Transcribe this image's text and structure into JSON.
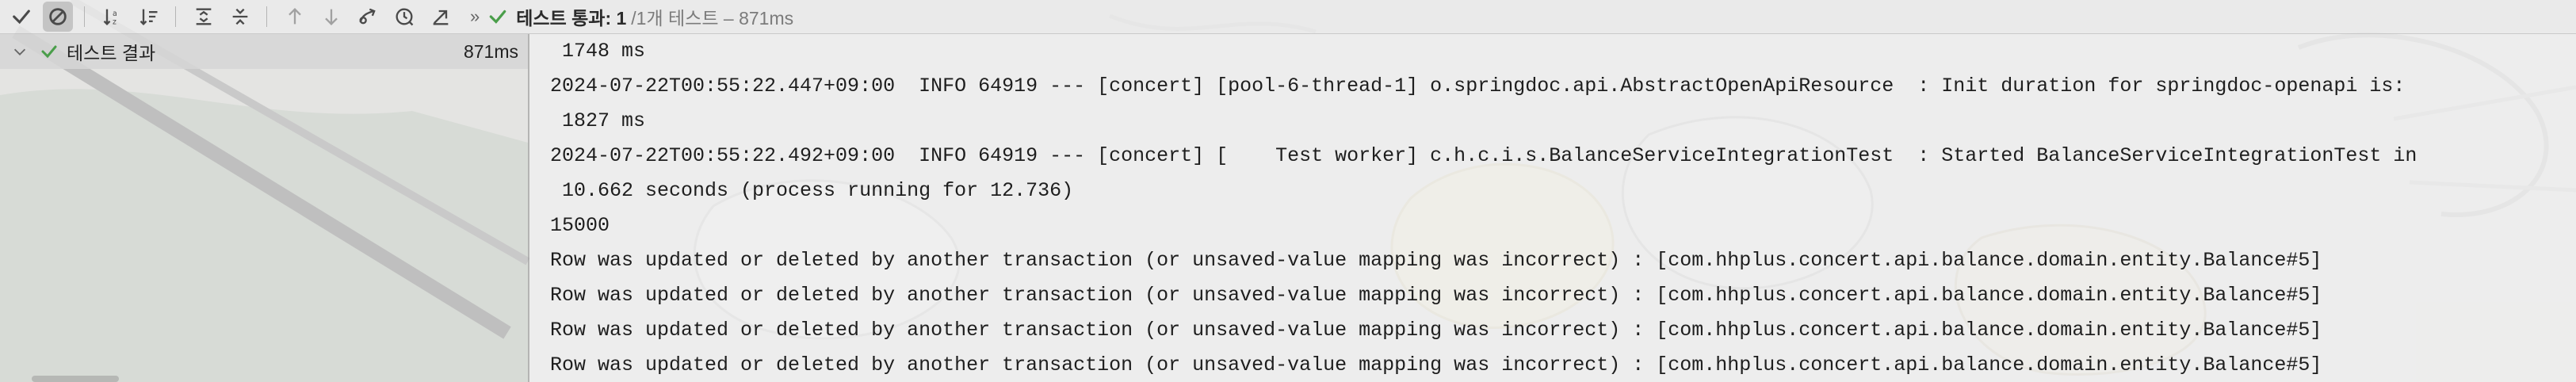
{
  "toolbar": {
    "buttons": [
      {
        "icon": "checkmark-icon",
        "name": "show-passed-button"
      },
      {
        "icon": "ignored-icon",
        "name": "show-ignored-button"
      },
      {
        "icon": "sort-alpha-icon",
        "name": "sort-alphabetically-button"
      },
      {
        "icon": "sort-duration-icon",
        "name": "sort-by-duration-button"
      },
      {
        "icon": "expand-all-icon",
        "name": "expand-all-button"
      },
      {
        "icon": "collapse-all-icon",
        "name": "collapse-all-button"
      },
      {
        "icon": "arrow-up-icon",
        "name": "previous-failed-button"
      },
      {
        "icon": "arrow-down-icon",
        "name": "next-failed-button"
      },
      {
        "icon": "import-tests-icon",
        "name": "import-tests-button"
      },
      {
        "icon": "history-icon",
        "name": "test-history-button"
      },
      {
        "icon": "export-icon",
        "name": "export-results-button"
      }
    ],
    "overflow": "»",
    "status_label": "테스트 통과: 1",
    "status_detail": "/1개 테스트 – 871ms"
  },
  "colors": {
    "pass": "#4a9e4a",
    "active_button": "#c4c4c4"
  },
  "tree": {
    "root": {
      "label": "테스트 결과",
      "duration": "871ms"
    }
  },
  "console": {
    "lines": [
      " 1748 ms",
      "2024-07-22T00:55:22.447+09:00  INFO 64919 --- [concert] [pool-6-thread-1] o.springdoc.api.AbstractOpenApiResource  : Init duration for springdoc-openapi is:",
      " 1827 ms",
      "2024-07-22T00:55:22.492+09:00  INFO 64919 --- [concert] [    Test worker] c.h.c.i.s.BalanceServiceIntegrationTest  : Started BalanceServiceIntegrationTest in",
      " 10.662 seconds (process running for 12.736)",
      "15000",
      "Row was updated or deleted by another transaction (or unsaved-value mapping was incorrect) : [com.hhplus.concert.api.balance.domain.entity.Balance#5]",
      "Row was updated or deleted by another transaction (or unsaved-value mapping was incorrect) : [com.hhplus.concert.api.balance.domain.entity.Balance#5]",
      "Row was updated or deleted by another transaction (or unsaved-value mapping was incorrect) : [com.hhplus.concert.api.balance.domain.entity.Balance#5]",
      "Row was updated or deleted by another transaction (or unsaved-value mapping was incorrect) : [com.hhplus.concert.api.balance.domain.entity.Balance#5]"
    ]
  }
}
